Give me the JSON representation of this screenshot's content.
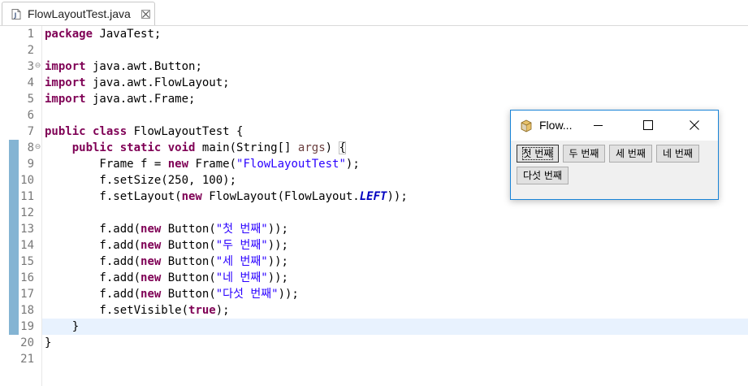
{
  "editor": {
    "tab": {
      "label": "FlowLayoutTest.java",
      "icon": "java-file-icon",
      "close_icon": "close-icon"
    },
    "current_line": 19,
    "lines": [
      {
        "n": "1",
        "fold": "",
        "parts": [
          [
            "kw",
            "package"
          ],
          [
            "",
            ""
          ],
          [
            "",
            " JavaTest;"
          ]
        ]
      },
      {
        "n": "2",
        "fold": "",
        "parts": []
      },
      {
        "n": "3",
        "fold": "⊖",
        "parts": [
          [
            "kw",
            "import"
          ],
          [
            "",
            " java.awt.Button;"
          ]
        ]
      },
      {
        "n": "4",
        "fold": "",
        "parts": [
          [
            "kw",
            "import"
          ],
          [
            "",
            " java.awt.FlowLayout;"
          ]
        ]
      },
      {
        "n": "5",
        "fold": "",
        "parts": [
          [
            "kw",
            "import"
          ],
          [
            "",
            " java.awt.Frame;"
          ]
        ]
      },
      {
        "n": "6",
        "fold": "",
        "parts": []
      },
      {
        "n": "7",
        "fold": "",
        "parts": [
          [
            "kw",
            "public"
          ],
          [
            "",
            " "
          ],
          [
            "kw",
            "class"
          ],
          [
            "",
            " FlowLayoutTest {"
          ]
        ]
      },
      {
        "n": "8",
        "fold": "⊖",
        "parts": [
          [
            "",
            "    "
          ],
          [
            "kw",
            "public"
          ],
          [
            "",
            " "
          ],
          [
            "kw",
            "static"
          ],
          [
            "",
            " "
          ],
          [
            "kw",
            "void"
          ],
          [
            "",
            " main(String[] "
          ],
          [
            "arg",
            "args"
          ],
          [
            "",
            ") "
          ],
          [
            "brace",
            "{"
          ]
        ]
      },
      {
        "n": "9",
        "fold": "",
        "parts": [
          [
            "",
            "        Frame f = "
          ],
          [
            "kw",
            "new"
          ],
          [
            "",
            " Frame("
          ],
          [
            "str",
            "\"FlowLayoutTest\""
          ],
          [
            "",
            ");"
          ]
        ]
      },
      {
        "n": "10",
        "fold": "",
        "parts": [
          [
            "",
            "        f.setSize(250, 100);"
          ]
        ]
      },
      {
        "n": "11",
        "fold": "",
        "parts": [
          [
            "",
            "        f.setLayout("
          ],
          [
            "kw",
            "new"
          ],
          [
            "",
            " FlowLayout(FlowLayout."
          ],
          [
            "fld",
            "LEFT"
          ],
          [
            "",
            "));"
          ]
        ]
      },
      {
        "n": "12",
        "fold": "",
        "parts": []
      },
      {
        "n": "13",
        "fold": "",
        "parts": [
          [
            "",
            "        f.add("
          ],
          [
            "kw",
            "new"
          ],
          [
            "",
            " Button("
          ],
          [
            "str",
            "\"첫 번째\""
          ],
          [
            "",
            "));"
          ]
        ]
      },
      {
        "n": "14",
        "fold": "",
        "parts": [
          [
            "",
            "        f.add("
          ],
          [
            "kw",
            "new"
          ],
          [
            "",
            " Button("
          ],
          [
            "str",
            "\"두 번째\""
          ],
          [
            "",
            "));"
          ]
        ]
      },
      {
        "n": "15",
        "fold": "",
        "parts": [
          [
            "",
            "        f.add("
          ],
          [
            "kw",
            "new"
          ],
          [
            "",
            " Button("
          ],
          [
            "str",
            "\"세 번째\""
          ],
          [
            "",
            "));"
          ]
        ]
      },
      {
        "n": "16",
        "fold": "",
        "parts": [
          [
            "",
            "        f.add("
          ],
          [
            "kw",
            "new"
          ],
          [
            "",
            " Button("
          ],
          [
            "str",
            "\"네 번째\""
          ],
          [
            "",
            "));"
          ]
        ]
      },
      {
        "n": "17",
        "fold": "",
        "parts": [
          [
            "",
            "        f.add("
          ],
          [
            "kw",
            "new"
          ],
          [
            "",
            " Button("
          ],
          [
            "str",
            "\"다섯 번째\""
          ],
          [
            "",
            "));"
          ]
        ]
      },
      {
        "n": "18",
        "fold": "",
        "parts": [
          [
            "",
            "        f.setVisible("
          ],
          [
            "kw",
            "true"
          ],
          [
            "",
            ");"
          ]
        ]
      },
      {
        "n": "19",
        "fold": "",
        "parts": [
          [
            "",
            "    }"
          ]
        ]
      },
      {
        "n": "20",
        "fold": "",
        "parts": [
          [
            "",
            "}"
          ]
        ]
      },
      {
        "n": "21",
        "fold": "",
        "parts": []
      }
    ]
  },
  "awt_window": {
    "title": "Flow...",
    "minimize_icon": "minimize-icon",
    "maximize_icon": "maximize-icon",
    "close_icon": "close-icon",
    "buttons": [
      {
        "label": "첫 번째",
        "focused": true
      },
      {
        "label": "두 번째",
        "focused": false
      },
      {
        "label": "세 번째",
        "focused": false
      },
      {
        "label": "네 번째",
        "focused": false
      },
      {
        "label": "다섯 번째",
        "focused": false
      }
    ]
  },
  "colors": {
    "keyword": "#7f0055",
    "string": "#2a00ff",
    "static_field": "#0000c0",
    "current_line": "#e8f2fe",
    "change_bar": "#5b9bc4",
    "window_border": "#1883d7"
  }
}
